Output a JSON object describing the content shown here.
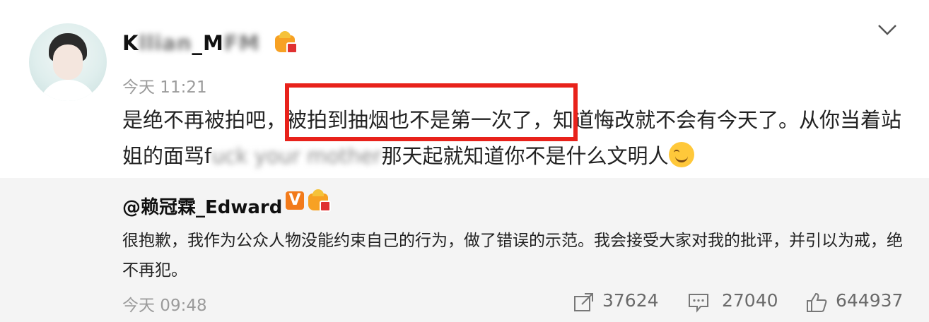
{
  "post": {
    "username_visible": "K",
    "username_blurred": "llian",
    "username_tail": "_M",
    "username_blurred2": "FM",
    "time": "今天 11:21",
    "content_part1": "是绝不再被拍吧，",
    "content_highlight": "被拍到抽烟也不是第一次了，",
    "content_part2": "知道悔改就不会有今天了。从你当着站姐的面骂f",
    "content_blurred": "uck your mother",
    "content_part3": "那天起就知道你不是什么文明人"
  },
  "reply": {
    "username": "@赖冠霖_Edward",
    "verified_badge": "V",
    "text": "很抱歉，我作为公众人物没能约束自己的行为，做了错误的示范。我会接受大家对我的批评，并引以为戒，绝不再犯。",
    "time": "今天 09:48"
  },
  "actions": {
    "repost_count": "37624",
    "comment_count": "27040",
    "like_count": "644937"
  },
  "icons": [
    "avatar",
    "crown-badge-icon",
    "chevron-down-icon",
    "smile-emoji-icon",
    "verified-v-icon",
    "repost-icon",
    "comment-icon",
    "like-icon"
  ],
  "colors": {
    "highlight": "#e8221b",
    "badge_orange": "#f27a1a",
    "crown": "#f7a123"
  }
}
